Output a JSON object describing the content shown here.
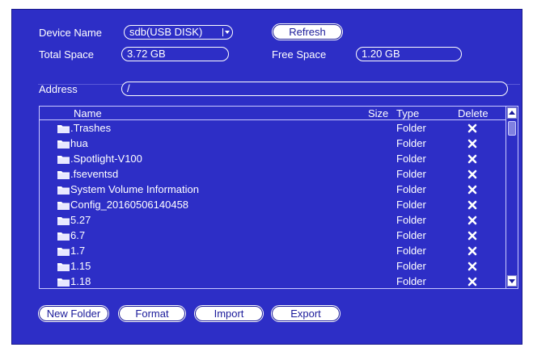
{
  "device": {
    "name_label": "Device Name",
    "name_value": "sdb(USB DISK)",
    "refresh_label": "Refresh",
    "total_label": "Total Space",
    "total_value": "3.72 GB",
    "free_label": "Free Space",
    "free_value": "1.20 GB"
  },
  "address": {
    "label": "Address",
    "value": "/"
  },
  "table": {
    "columns": {
      "name": "Name",
      "size": "Size",
      "type": "Type",
      "delete": "Delete"
    },
    "rows": [
      {
        "name": ".Trashes",
        "size": "",
        "type": "Folder"
      },
      {
        "name": "hua",
        "size": "",
        "type": "Folder"
      },
      {
        "name": ".Spotlight-V100",
        "size": "",
        "type": "Folder"
      },
      {
        "name": ".fseventsd",
        "size": "",
        "type": "Folder"
      },
      {
        "name": "System Volume Information",
        "size": "",
        "type": "Folder"
      },
      {
        "name": "Config_20160506140458",
        "size": "",
        "type": "Folder"
      },
      {
        "name": "5.27",
        "size": "",
        "type": "Folder"
      },
      {
        "name": "6.7",
        "size": "",
        "type": "Folder"
      },
      {
        "name": "1.7",
        "size": "",
        "type": "Folder"
      },
      {
        "name": "1.15",
        "size": "",
        "type": "Folder"
      },
      {
        "name": "1.18",
        "size": "",
        "type": "Folder"
      }
    ]
  },
  "actions": {
    "new_folder": "New Folder",
    "format": "Format",
    "import": "Import",
    "export": "Export"
  },
  "colors": {
    "panel_bg": "#2d2ec6",
    "text": "#ffffff",
    "button_bg": "#ffffff",
    "button_text": "#1a1a9a"
  }
}
